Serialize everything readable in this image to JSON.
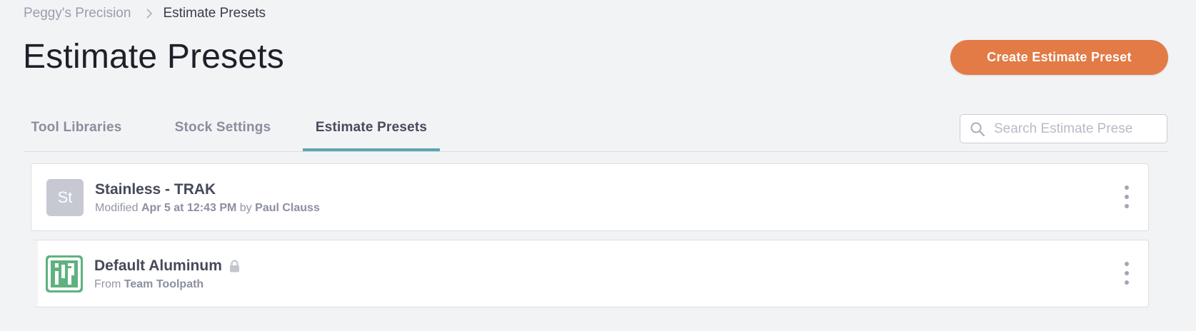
{
  "breadcrumb": {
    "parent": "Peggy's Precision",
    "current": "Estimate Presets"
  },
  "page": {
    "title": "Estimate Presets",
    "create_button": "Create Estimate Preset"
  },
  "tabs": [
    {
      "label": "Tool Libraries",
      "active": false
    },
    {
      "label": "Stock Settings",
      "active": false
    },
    {
      "label": "Estimate Presets",
      "active": true
    }
  ],
  "search": {
    "placeholder": "Search Estimate Prese",
    "value": ""
  },
  "presets": [
    {
      "initials": "St",
      "name": "Stainless - TRAK",
      "meta_prefix": "Modified",
      "modified_date": "Apr 5 at 12:43 PM",
      "meta_by": "by",
      "author": "Paul Clauss",
      "locked": false
    },
    {
      "name": "Default Aluminum",
      "meta_prefix": "From",
      "source": "Team Toolpath",
      "locked": true,
      "logo_color": "#5fb27f"
    }
  ],
  "colors": {
    "accent": "#e27b45",
    "tab_indicator": "#5da4ad",
    "background": "#f2f3f5"
  }
}
